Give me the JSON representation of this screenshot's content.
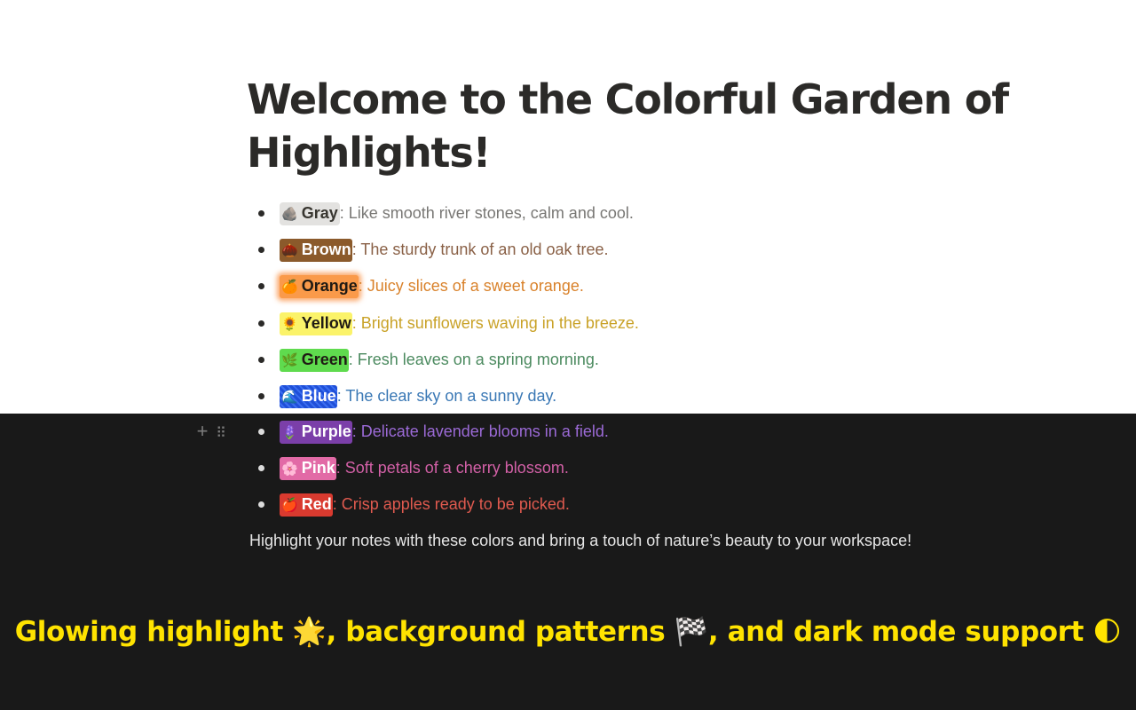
{
  "page": {
    "title": "Welcome to the Colorful Garden of Highlights!",
    "footer_note": "Highlight your notes with these colors and bring a touch of nature’s beauty to your workspace!"
  },
  "items": [
    {
      "emoji": "🪨",
      "label": "Gray",
      "desc": ": Like smooth river stones, calm and cool.",
      "chip_bg": "#e3e2e0",
      "chip_fg": "#37352f",
      "desc_color": "#787774"
    },
    {
      "emoji": "🌰",
      "label": "Brown",
      "desc": ": The sturdy trunk of an old oak tree.",
      "chip_bg": "#8b5a2b",
      "chip_fg": "#ffffff",
      "desc_color": "#8a6147"
    },
    {
      "emoji": "🍊",
      "label": "Orange",
      "desc": ": Juicy slices of a sweet orange.",
      "chip_bg": "#fa9a4a",
      "chip_fg": "#1f1a14",
      "desc_color": "#d9822b"
    },
    {
      "emoji": "🌻",
      "label": "Yellow",
      "desc": ": Bright sunflowers waving in the breeze.",
      "chip_bg": "#fbf36a",
      "chip_fg": "#1f1a14",
      "desc_color": "#c9a227"
    },
    {
      "emoji": "🌿",
      "label": "Green",
      "desc": ": Fresh leaves on a spring morning.",
      "chip_bg": "#5fdb4e",
      "chip_fg": "#1f1a14",
      "desc_color": "#4b8a5f"
    },
    {
      "emoji": "🌊",
      "label": "Blue",
      "desc": ": The clear sky on a sunny day.",
      "chip_bg": "#1f4fd8",
      "chip_fg": "#ffffff",
      "desc_color": "#3a78b5"
    },
    {
      "emoji": "🪻",
      "label": "Purple",
      "desc": ": Delicate lavender blooms in a field.",
      "chip_bg": "#7b3fa9",
      "chip_fg": "#ffffff",
      "desc_color": "#9b6ad6"
    },
    {
      "emoji": "🌸",
      "label": "Pink",
      "desc": ": Soft petals of a cherry blossom.",
      "chip_bg": "#e26aa6",
      "chip_fg": "#ffffff",
      "desc_color": "#d260a6"
    },
    {
      "emoji": "🍎",
      "label": "Red",
      "desc": ": Crisp apples ready to be picked.",
      "chip_bg": "#d93a2f",
      "chip_fg": "#ffffff",
      "desc_color": "#e05a4f"
    }
  ],
  "block_controls": {
    "add": "+",
    "drag": "⠿"
  },
  "caption": {
    "part1": "Glowing highlight ",
    "emoji1": "🌟",
    "part2": ", background patterns ",
    "emoji2": "🏁",
    "part3": ", and dark mode support ",
    "emoji3": "🌓"
  },
  "colors": {
    "dark_bg": "#191919",
    "caption_yellow": "#ffe300"
  }
}
